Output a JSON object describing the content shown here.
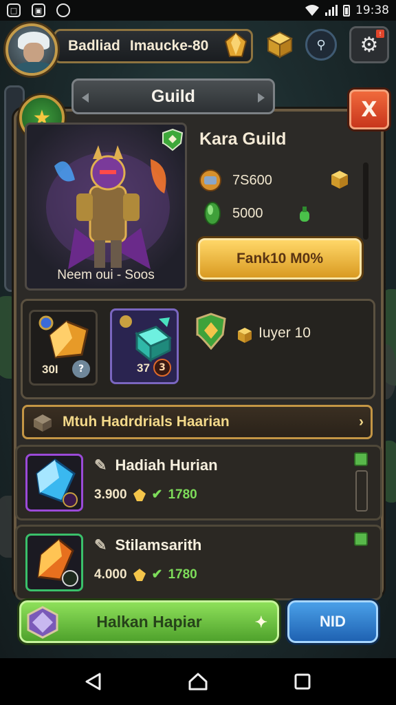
{
  "status_bar": {
    "time": "19:38",
    "icons": [
      "app-icon",
      "app-icon",
      "circle-icon",
      "wifi-icon",
      "signal-icon",
      "battery-icon"
    ]
  },
  "header": {
    "player_name": "Badliad",
    "player_subtitle": "Imaucke-80"
  },
  "panel": {
    "title": "Guild",
    "close_label": "X",
    "guild_name": "Kara Guild",
    "hero_caption": "Neem oui - Soos",
    "stat_coins": "7S600",
    "stat_gems": "5000",
    "main_action": "Fank10 M0%"
  },
  "items": [
    {
      "count": "30I",
      "badge": "?"
    },
    {
      "count": "37",
      "badge": "3"
    }
  ],
  "tier_label": "Iuyer 10",
  "section_title": "Mtuh Hadrdrials Haarian",
  "rows": [
    {
      "title": "Hadiah Hurian",
      "cost": "3.900",
      "reward": "1780",
      "badge": "+"
    },
    {
      "title": "Stilamsarith",
      "cost": "4.000",
      "reward": "1780",
      "badge": "+"
    }
  ],
  "buttons": {
    "primary": "Halkan Hapiar",
    "secondary": "NID"
  },
  "colors": {
    "gold": "#f4c54a",
    "green": "#62c23a",
    "blue": "#2f7fd2",
    "close_red": "#e0502a"
  }
}
